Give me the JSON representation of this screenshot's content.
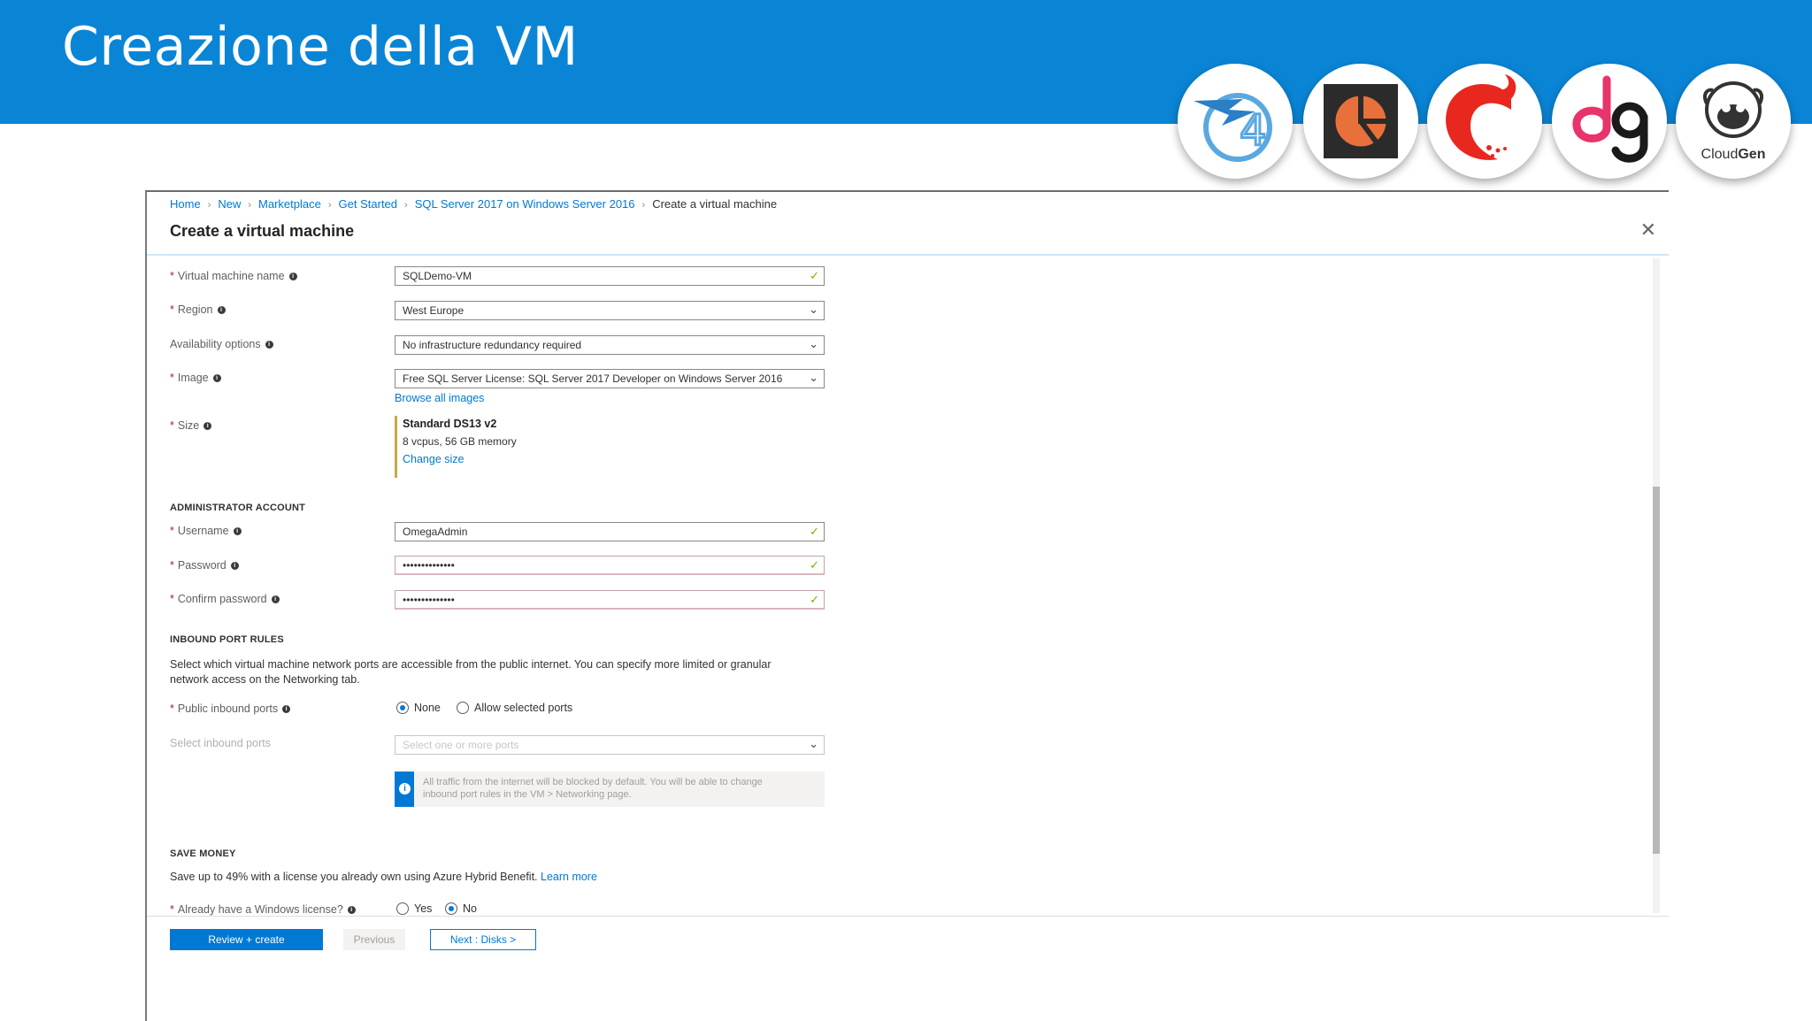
{
  "slide": {
    "title": "Creazione della VM",
    "logos": [
      {
        "name": "sql4-logo",
        "text": ""
      },
      {
        "name": "powerbi-style-logo",
        "text": ""
      },
      {
        "name": "red-swirl-logo",
        "text": ""
      },
      {
        "name": "dg-logo",
        "text": ""
      },
      {
        "name": "cloudgen-logo",
        "text_a": "Cloud",
        "text_b": "Gen"
      }
    ],
    "colors": {
      "header": "#0a85d6",
      "accent": "#0078d4",
      "required": "#a4262c",
      "valid": "#6bb700"
    }
  },
  "portal": {
    "breadcrumb": [
      "Home",
      "New",
      "Marketplace",
      "Get Started",
      "SQL Server 2017 on Windows Server 2016",
      "Create a virtual machine"
    ],
    "title": "Create a virtual machine",
    "close": "✕",
    "fields": {
      "vm_name": {
        "label": "Virtual machine name",
        "value": "SQLDemo-VM"
      },
      "region": {
        "label": "Region",
        "value": "West Europe"
      },
      "availability": {
        "label": "Availability options",
        "value": "No infrastructure redundancy required"
      },
      "image": {
        "label": "Image",
        "value": "Free SQL Server License: SQL Server 2017 Developer on Windows Server 2016",
        "link": "Browse all images"
      },
      "size": {
        "label": "Size",
        "name": "Standard DS13 v2",
        "desc": "8 vcpus, 56 GB memory",
        "link": "Change size"
      }
    },
    "admin": {
      "section": "ADMINISTRATOR ACCOUNT",
      "username": {
        "label": "Username",
        "value": "OmegaAdmin"
      },
      "password": {
        "label": "Password",
        "value": "••••••••••••••"
      },
      "confirm": {
        "label": "Confirm password",
        "value": "••••••••••••••"
      }
    },
    "inbound": {
      "section": "INBOUND PORT RULES",
      "desc1": "Select which virtual machine network ports are accessible from the public internet. You can specify more limited or granular",
      "desc2": "network access on the Networking tab.",
      "public_label": "Public inbound ports",
      "opt_none": "None",
      "opt_allow": "Allow selected ports",
      "selected": "None",
      "select_label": "Select inbound ports",
      "select_placeholder": "Select one or more ports",
      "info1": "All traffic from the internet will be blocked by default. You will be able to change",
      "info2": "inbound port rules in the VM > Networking page."
    },
    "save": {
      "section": "SAVE MONEY",
      "desc": "Save up to 49% with a license you already own using Azure Hybrid Benefit.",
      "learn": "Learn more",
      "license_label": "Already have a Windows license?",
      "opt_yes": "Yes",
      "opt_no": "No",
      "selected": "No"
    },
    "buttons": {
      "review": "Review + create",
      "previous": "Previous",
      "next": "Next : Disks >"
    }
  }
}
